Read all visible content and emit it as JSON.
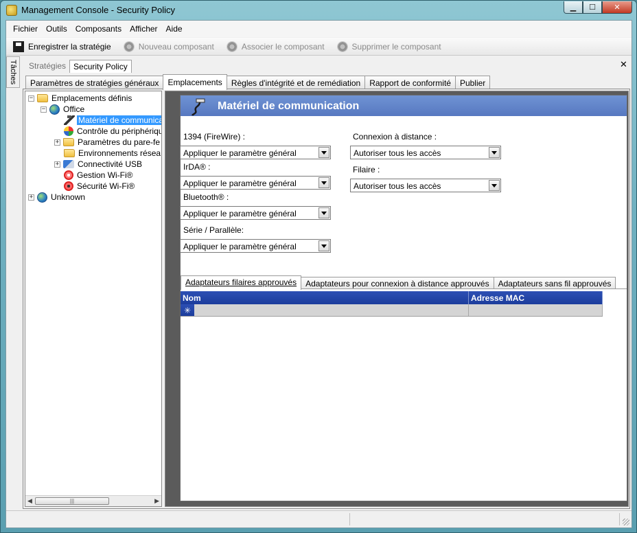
{
  "window": {
    "title": "Management Console  -  Security Policy",
    "caption_min": "▁",
    "caption_max": "☐",
    "caption_close": "✕"
  },
  "menu": [
    "Fichier",
    "Outils",
    "Composants",
    "Afficher",
    "Aide"
  ],
  "toolbar": {
    "save": "Enregistrer la stratégie",
    "new_component": "Nouveau composant",
    "associate_component": "Associer le composant",
    "delete_component": "Supprimer le composant"
  },
  "side_strip": "Tâches",
  "close_pane": "✕",
  "doc_tabs": [
    "Stratégies",
    "Security Policy"
  ],
  "main_tabs": [
    "Paramètres de stratégies généraux",
    "Emplacements",
    "Règles d'intégrité et de remédiation",
    "Rapport de conformité",
    "Publier"
  ],
  "tree": {
    "root": "Emplacements définis",
    "office": "Office",
    "items": [
      "Matériel de communica",
      "Contrôle du périphériqu",
      "Paramètres du pare-fe",
      "Environnements résea",
      "Connectivité USB",
      "Gestion Wi-Fi®",
      "Sécurité Wi-Fi®"
    ],
    "unknown": "Unknown",
    "expand_minus": "−",
    "expand_plus": "+",
    "scroll_left": "◀",
    "scroll_right": "▶",
    "scroll_grip": "|||"
  },
  "panel": {
    "title": "Matériel de communication",
    "fields_left": [
      {
        "label": "1394 (FireWire) :",
        "value": "Appliquer le paramètre général"
      },
      {
        "label": "IrDA® :",
        "value": "Appliquer le paramètre général"
      },
      {
        "label": "Bluetooth® :",
        "value": "Appliquer le paramètre général"
      },
      {
        "label": "Série / Parallèle:",
        "value": "Appliquer le paramètre général"
      }
    ],
    "fields_right": [
      {
        "label": "Connexion à distance :",
        "value": "Autoriser tous les accès"
      },
      {
        "label": "Filaire :",
        "value": "Autoriser tous les accès"
      }
    ]
  },
  "sub_tabs": [
    "Adaptateurs filaires approuvés",
    "Adaptateurs pour connexion à distance approuvés",
    "Adaptateurs sans fil approuvés"
  ],
  "grid": {
    "columns": [
      "Nom",
      "Adresse MAC"
    ],
    "new_row_marker": "✳"
  }
}
